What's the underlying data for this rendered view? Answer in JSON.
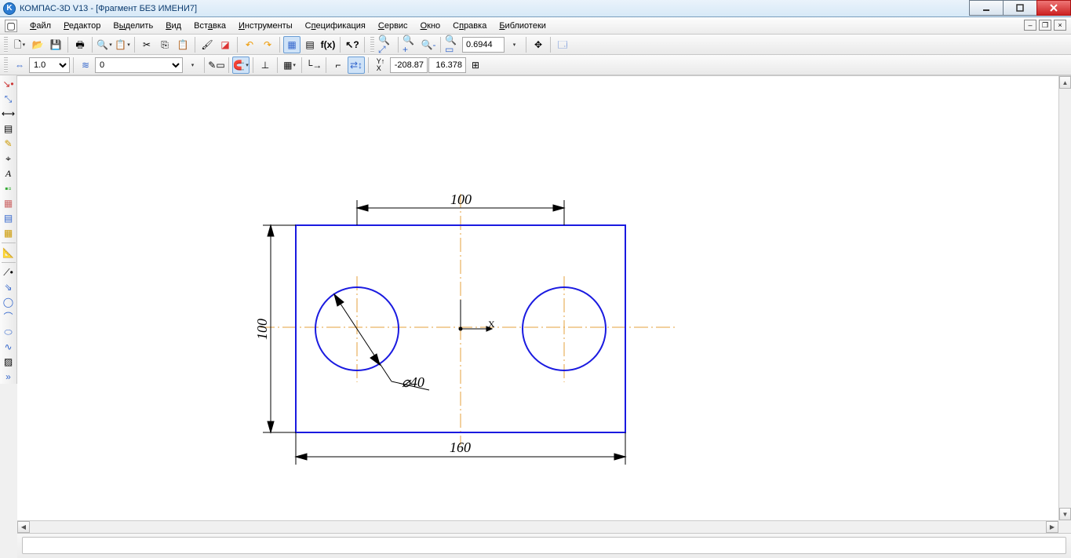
{
  "title": "КОМПАС-3D V13 - [Фрагмент БЕЗ ИМЕНИ7]",
  "app_icon_letter": "K",
  "menu": {
    "file": {
      "pre": "",
      "u": "Ф",
      "post": "айл"
    },
    "editor": {
      "pre": "",
      "u": "Р",
      "post": "едактор"
    },
    "select": {
      "pre": "В",
      "u": "ы",
      "post": "делить"
    },
    "view": {
      "pre": "",
      "u": "В",
      "post": "ид"
    },
    "insert": {
      "pre": "Вст",
      "u": "а",
      "post": "вка"
    },
    "tools": {
      "pre": "",
      "u": "И",
      "post": "нструменты"
    },
    "spec": {
      "pre": "С",
      "u": "п",
      "post": "ецификация"
    },
    "service": {
      "pre": "",
      "u": "С",
      "post": "ервис"
    },
    "window": {
      "pre": "",
      "u": "О",
      "post": "кно"
    },
    "help": {
      "pre": "С",
      "u": "п",
      "post": "равка"
    },
    "libs": {
      "pre": "",
      "u": "Б",
      "post": "иблиотеки"
    }
  },
  "toolbar1": {
    "zoom_value": "0.6944"
  },
  "toolbar2": {
    "step_value": "1.0",
    "layer_value": "0",
    "coord_x": "-208.87",
    "coord_y": "16.378"
  },
  "drawing": {
    "dim_top": "100",
    "dim_left": "100",
    "dim_bottom": "160",
    "dim_diameter": "⌀40",
    "origin_x_label": "X"
  }
}
